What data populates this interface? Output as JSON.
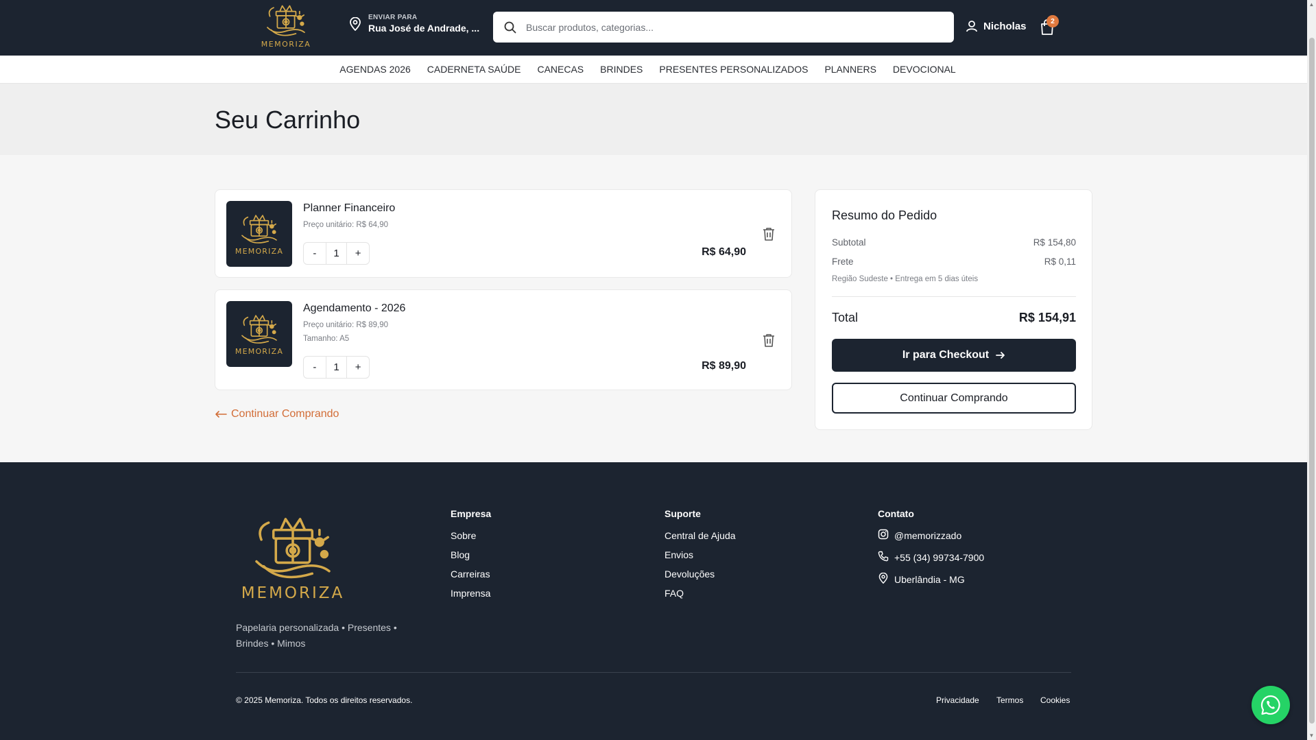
{
  "brand": {
    "name": "MEMORIZA",
    "gold": "#d4a94a",
    "navy": "#1c2430",
    "accent": "#d26d37"
  },
  "header": {
    "ship_label": "ENVIAR PARA",
    "ship_address": "Rua José de Andrade, ...",
    "search_placeholder": "Buscar produtos, categorias...",
    "user_name": "Nicholas",
    "cart_count": "2"
  },
  "nav": [
    "AGENDAS 2026",
    "CADERNETA SAÚDE",
    "CANECAS",
    "BRINDES",
    "PRESENTES PERSONALIZADOS",
    "PLANNERS",
    "DEVOCIONAL"
  ],
  "page": {
    "title": "Seu Carrinho"
  },
  "cart": {
    "items": [
      {
        "name": "Planner Financeiro",
        "unit_price": "Preço unitário: R$ 64,90",
        "variant": "",
        "qty_minus": "-",
        "qty": "1",
        "qty_plus": "+",
        "price": "R$ 64,90"
      },
      {
        "name": "Agendamento - 2026",
        "unit_price": "Preço unitário: R$ 89,90",
        "variant": "Tamanho: A5",
        "qty_minus": "-",
        "qty": "1",
        "qty_plus": "+",
        "price": "R$ 89,90"
      }
    ],
    "continue_link": "Continuar Comprando"
  },
  "summary": {
    "title": "Resumo do Pedido",
    "subtotal_label": "Subtotal",
    "subtotal_value": "R$ 154,80",
    "shipping_label": "Frete",
    "shipping_value": "R$ 0,11",
    "shipping_note": "Região Sudeste • Entrega em 5 dias úteis",
    "total_label": "Total",
    "total_value": "R$ 154,91",
    "checkout_label": "Ir para Checkout",
    "continue_label": "Continuar Comprando"
  },
  "footer": {
    "tagline": "Papelaria personalizada • Presentes • Brindes • Mimos",
    "empresa": {
      "title": "Empresa",
      "links": [
        "Sobre",
        "Blog",
        "Carreiras",
        "Imprensa"
      ]
    },
    "suporte": {
      "title": "Suporte",
      "links": [
        "Central de Ajuda",
        "Envios",
        "Devoluções",
        "FAQ"
      ]
    },
    "contato": {
      "title": "Contato",
      "instagram": "@memorizzado",
      "phone": "+55 (34) 99734-7900",
      "location": "Uberlândia - MG"
    },
    "copyright": "© 2025 Memoriza. Todos os direitos reservados.",
    "legal": [
      "Privacidade",
      "Termos",
      "Cookies"
    ]
  },
  "icons": [
    "location-pin-icon",
    "search-icon",
    "user-icon",
    "shopping-bag-icon",
    "trash-icon",
    "arrow-left-icon",
    "arrow-right-icon",
    "instagram-icon",
    "phone-icon",
    "whatsapp-icon"
  ]
}
